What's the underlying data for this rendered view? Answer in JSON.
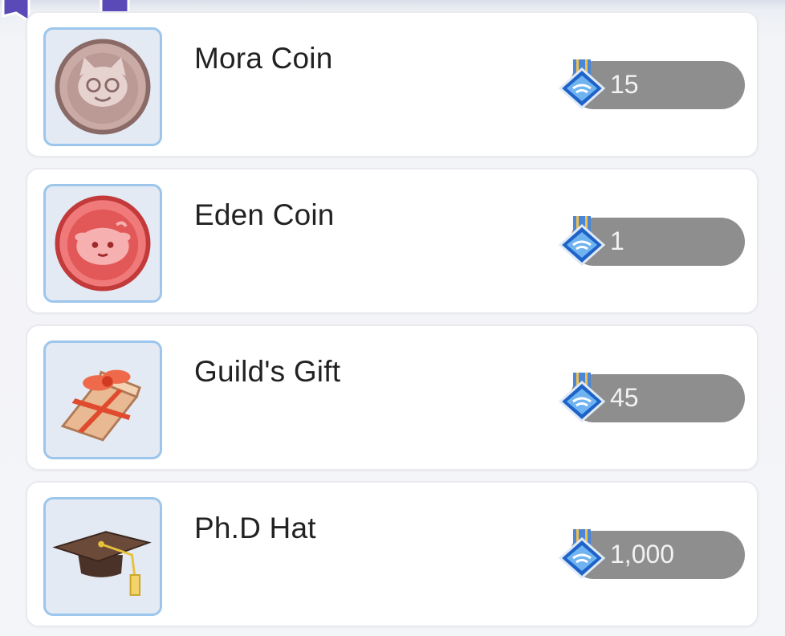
{
  "items": [
    {
      "name": "Mora Coin",
      "price": "15",
      "icon": "mora-coin-icon"
    },
    {
      "name": "Eden Coin",
      "price": "1",
      "icon": "eden-coin-icon"
    },
    {
      "name": "Guild's Gift",
      "price": "45",
      "icon": "gift-box-icon"
    },
    {
      "name": "Ph.D Hat",
      "price": "1,000",
      "icon": "graduation-cap-icon"
    }
  ],
  "currency_icon": "medal-gem-icon",
  "colors": {
    "card_bg": "#ffffff",
    "icon_frame_border": "#9cc6ec",
    "price_pill": "#8e8e8e",
    "gem_blue": "#2f6fd0",
    "badge_purple": "#5a4ab8"
  }
}
